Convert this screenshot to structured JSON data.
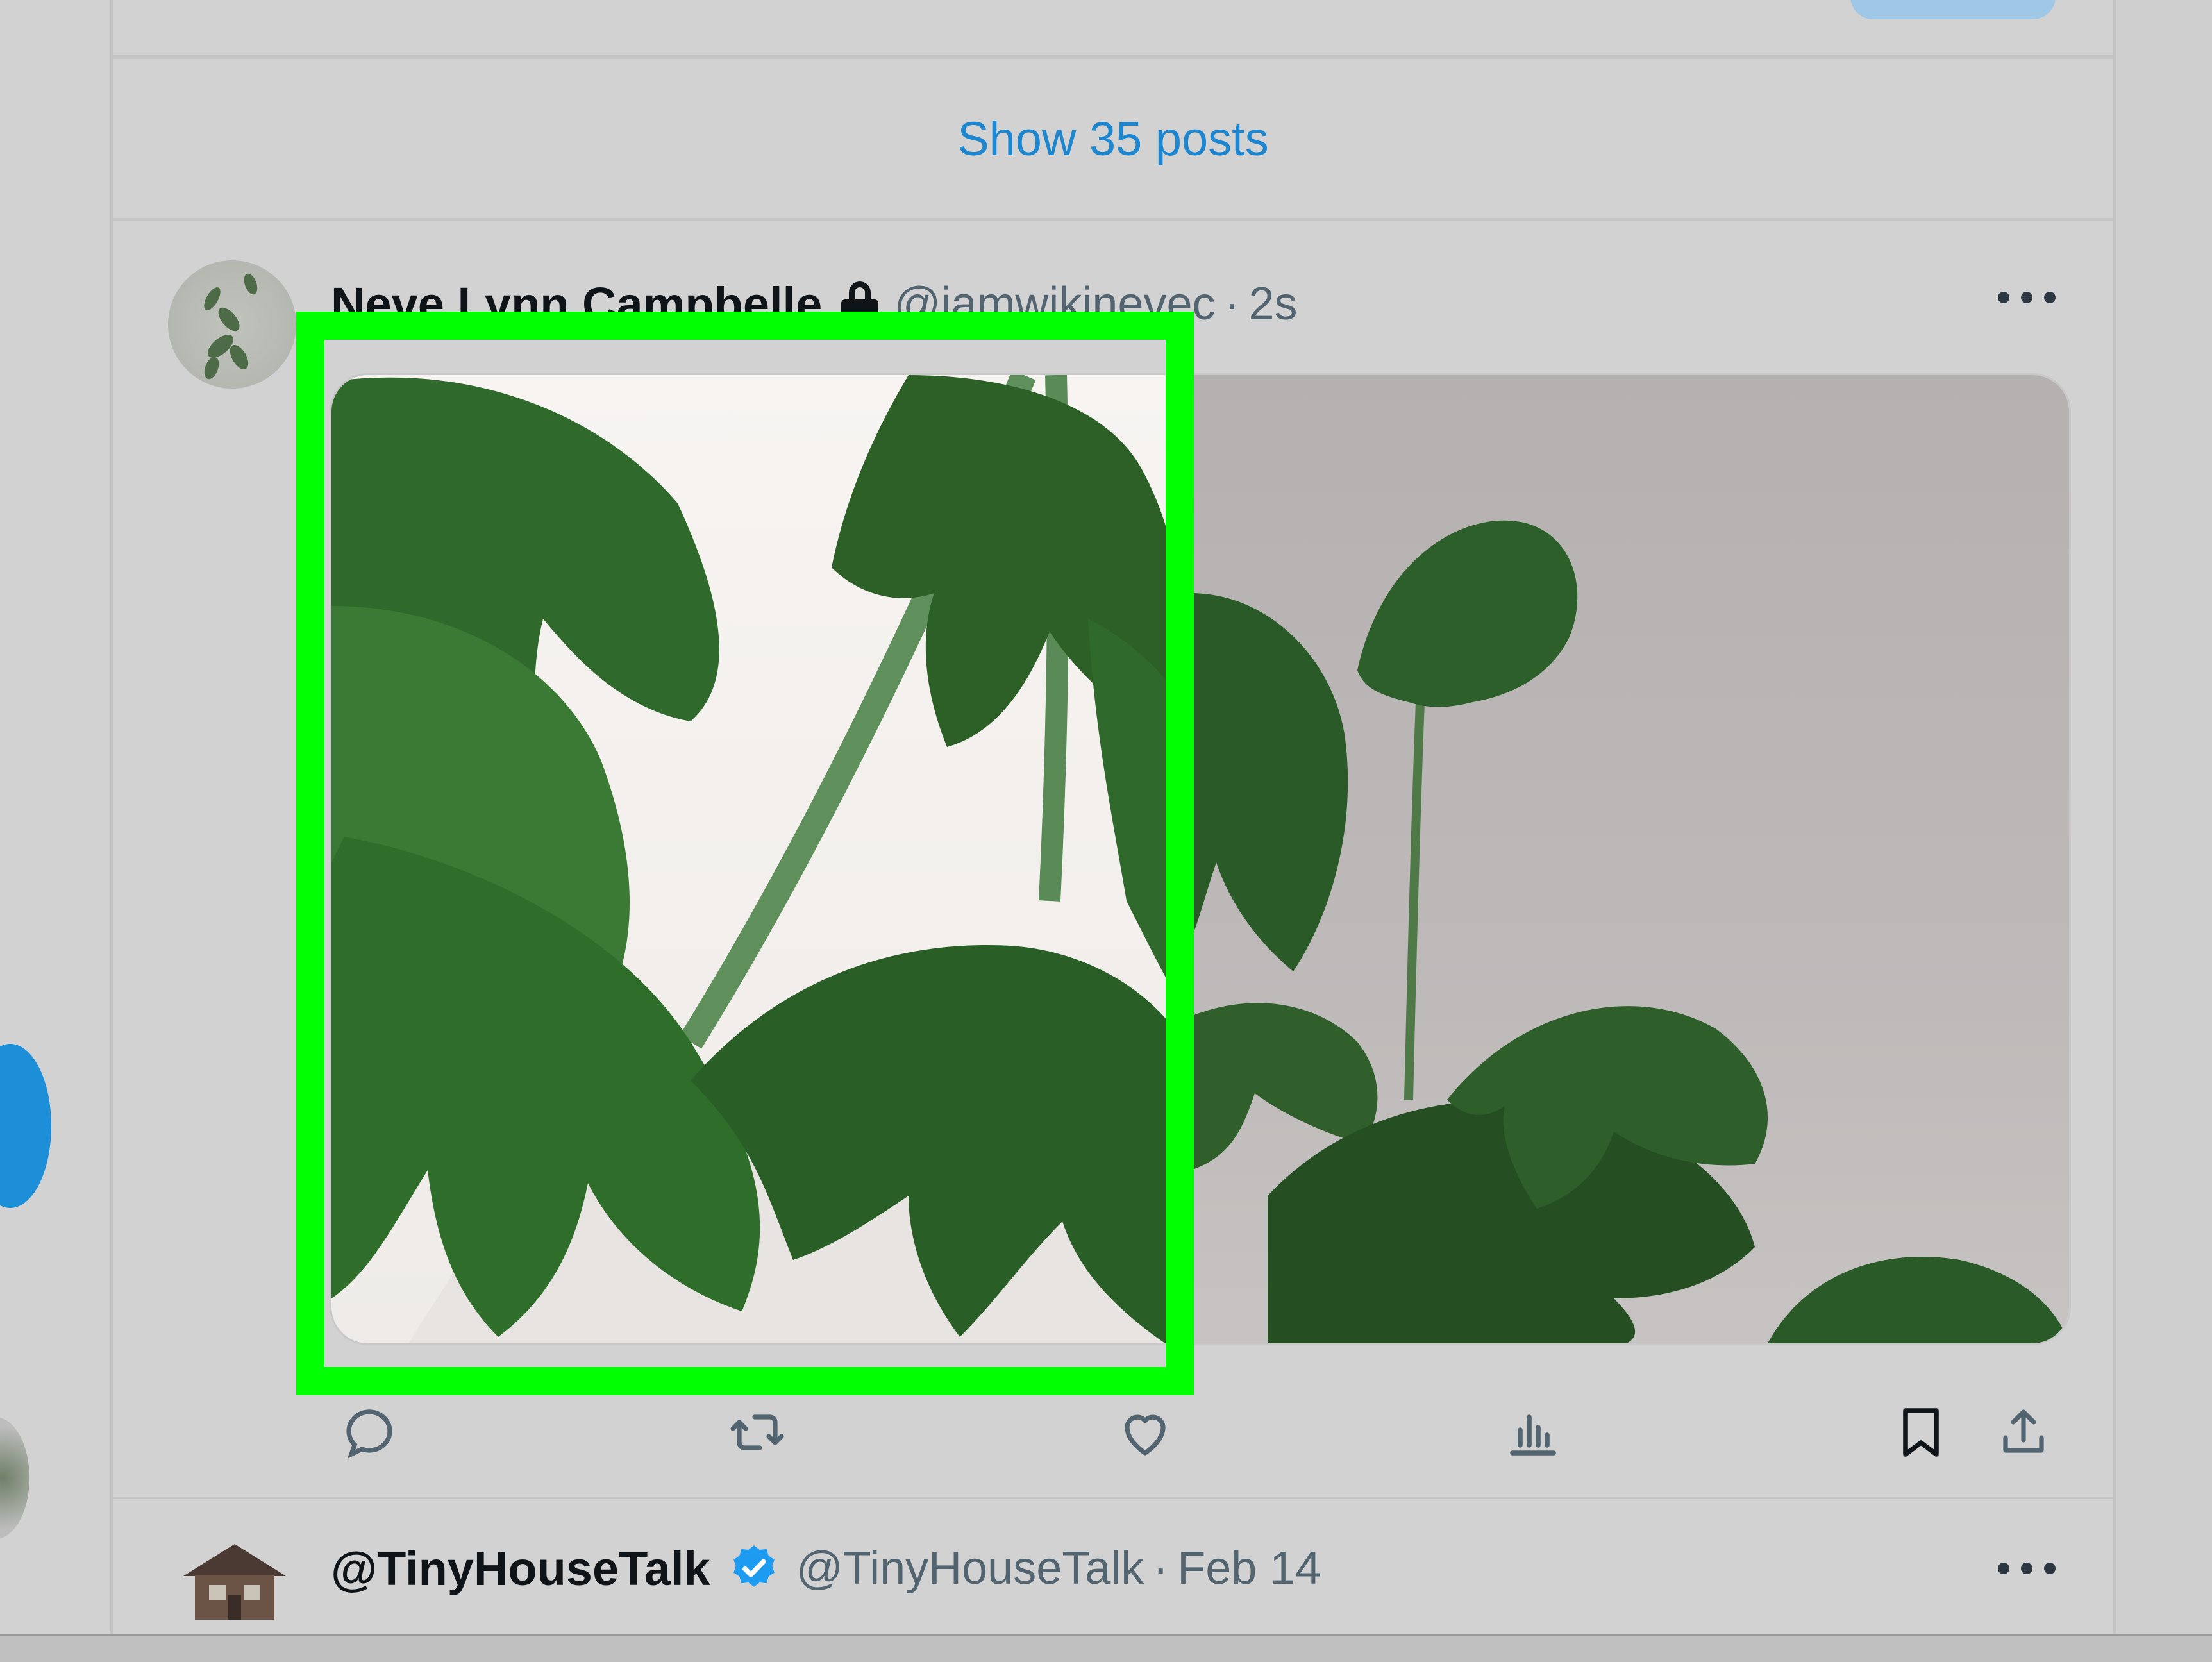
{
  "feed": {
    "show_posts_label": "Show 35 posts"
  },
  "post": {
    "display_name": "Neve Lynn Campbelle",
    "handle": "@iamwikinevec",
    "separator": "·",
    "time": "2s",
    "media": [
      {
        "subject": "monstera leaves on white background"
      },
      {
        "subject": "monstera plant against grey wall"
      }
    ],
    "highlight_color": "#00ff00"
  },
  "post2": {
    "display_name": "@TinyHouseTalk",
    "handle": "@TinyHouseTalk",
    "separator": "·",
    "time": "Feb 14"
  },
  "colors": {
    "accent": "#1d86cf",
    "verified": "#1d9bf0",
    "highlight": "#00ff00"
  },
  "icons": [
    "lock-icon",
    "more-icon",
    "reply-icon",
    "repost-icon",
    "like-icon",
    "views-icon",
    "bookmark-icon",
    "share-icon",
    "verified-icon"
  ]
}
